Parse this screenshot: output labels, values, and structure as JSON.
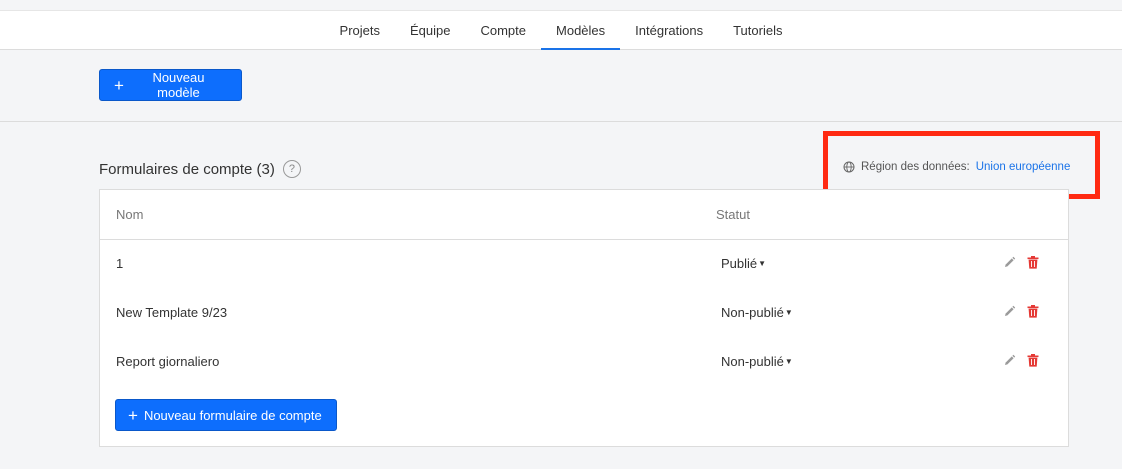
{
  "nav": {
    "tabs": [
      {
        "label": "Projets"
      },
      {
        "label": "Équipe"
      },
      {
        "label": "Compte"
      },
      {
        "label": "Modèles",
        "active": true
      },
      {
        "label": "Intégrations"
      },
      {
        "label": "Tutoriels"
      }
    ]
  },
  "toolbar": {
    "new_model_label": "Nouveau modèle"
  },
  "section": {
    "title": "Formulaires de compte (3)",
    "help": "?"
  },
  "region": {
    "label": "Région des données:",
    "value": "Union européenne"
  },
  "table": {
    "headers": {
      "name": "Nom",
      "status": "Statut"
    },
    "rows": [
      {
        "name": "1",
        "status": "Publié"
      },
      {
        "name": "New Template 9/23",
        "status": "Non-publié"
      },
      {
        "name": "Report giornaliero",
        "status": "Non-publié"
      }
    ],
    "new_form_label": "Nouveau formulaire de compte"
  },
  "colors": {
    "accent": "#0d6efd",
    "delete": "#e53935",
    "highlight": "#ff2a12"
  },
  "icons": {
    "plus": "plus-icon",
    "help": "help-icon",
    "globe": "globe-icon",
    "edit": "pencil-icon",
    "delete": "trash-icon"
  }
}
